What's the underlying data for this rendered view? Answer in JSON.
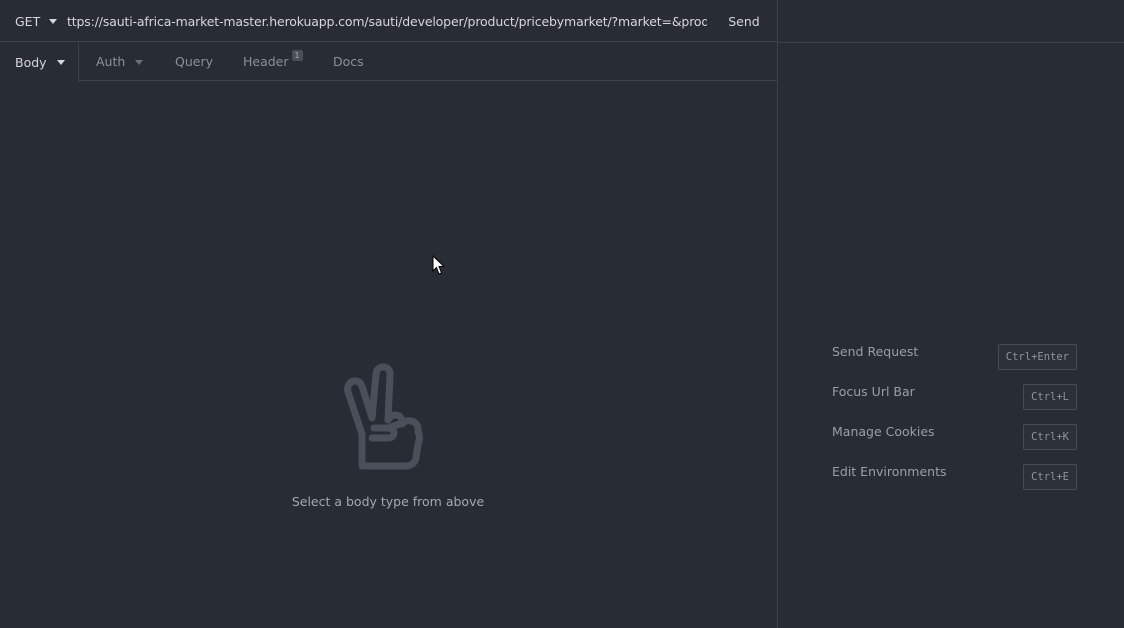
{
  "request": {
    "method": "GET",
    "url": "ttps://sauti-africa-market-master.herokuapp.com/sauti/developer/product/pricebymarket/?market=&product=",
    "send_label": "Send"
  },
  "tabs": [
    {
      "label": "Body",
      "active": true
    },
    {
      "label": "Auth"
    },
    {
      "label": "Query"
    },
    {
      "label": "Header",
      "badge": "1"
    },
    {
      "label": "Docs"
    }
  ],
  "body": {
    "empty_icon": "peace-hand-icon",
    "empty_message": "Select a body type from above"
  },
  "shortcuts": [
    {
      "label": "Send Request",
      "key": "Ctrl+Enter"
    },
    {
      "label": "Focus Url Bar",
      "key": "Ctrl+L"
    },
    {
      "label": "Manage Cookies",
      "key": "Ctrl+K"
    },
    {
      "label": "Edit Environments",
      "key": "Ctrl+E"
    }
  ],
  "colors": {
    "background": "#282c34",
    "border": "#3d414a",
    "text": "#d4d7dc",
    "muted_text": "#8b9099"
  }
}
